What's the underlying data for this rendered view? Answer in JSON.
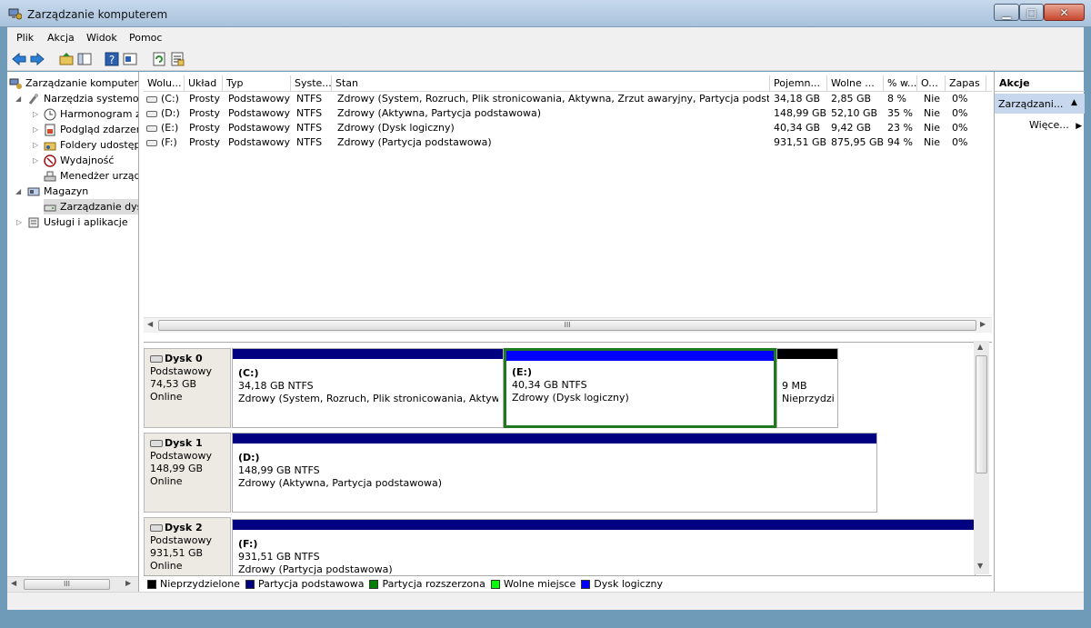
{
  "window": {
    "title": "Zarządzanie komputerem",
    "minimize": "▁",
    "maximize": "□",
    "close": "✕"
  },
  "menu": [
    "Plik",
    "Akcja",
    "Widok",
    "Pomoc"
  ],
  "toolbar": {
    "icons": [
      "back-arrow-icon",
      "forward-arrow-icon",
      "up-folder-icon",
      "show-hide-tree-icon",
      "help-icon",
      "properties-icon",
      "refresh-icon",
      "export-list-icon"
    ]
  },
  "tree": {
    "items": [
      {
        "label": "Zarządzanie komputerem (lokalne)",
        "icon": "computer-management-icon",
        "level": 0,
        "expander": "",
        "selected": false
      },
      {
        "label": "Narzędzia systemowe",
        "icon": "system-tools-icon",
        "level": 1,
        "expander": "◢",
        "selected": false
      },
      {
        "label": "Harmonogram zadań",
        "icon": "clock-icon",
        "level": 2,
        "expander": "▷",
        "selected": false
      },
      {
        "label": "Podgląd zdarzeń",
        "icon": "event-viewer-icon",
        "level": 2,
        "expander": "▷",
        "selected": false
      },
      {
        "label": "Foldery udostępnione",
        "icon": "shared-folder-icon",
        "level": 2,
        "expander": "▷",
        "selected": false
      },
      {
        "label": "Wydajność",
        "icon": "performance-icon",
        "level": 2,
        "expander": "▷",
        "selected": false
      },
      {
        "label": "Menedżer urządzeń",
        "icon": "device-manager-icon",
        "level": 2,
        "expander": "",
        "selected": false
      },
      {
        "label": "Magazyn",
        "icon": "storage-icon",
        "level": 1,
        "expander": "◢",
        "selected": false
      },
      {
        "label": "Zarządzanie dyskami",
        "icon": "disk-management-icon",
        "level": 2,
        "expander": "",
        "selected": true
      },
      {
        "label": "Usługi i aplikacje",
        "icon": "services-icon",
        "level": 1,
        "expander": "▷",
        "selected": false
      }
    ]
  },
  "volume_list": {
    "columns": [
      "Wolu...",
      "Układ",
      "Typ",
      "Syste...",
      "Stan",
      "Pojemn...",
      "Wolne ...",
      "% w...",
      "O...",
      "Zapas"
    ],
    "rows": [
      [
        "(C:)",
        "Prosty",
        "Podstawowy",
        "NTFS",
        "Zdrowy (System, Rozruch, Plik stronicowania, Aktywna, Zrzut awaryjny, Partycja podstawowa)",
        "34,18 GB",
        "2,85 GB",
        "8 %",
        "Nie",
        "0%"
      ],
      [
        "(D:)",
        "Prosty",
        "Podstawowy",
        "NTFS",
        "Zdrowy (Aktywna, Partycja podstawowa)",
        "148,99 GB",
        "52,10 GB",
        "35 %",
        "Nie",
        "0%"
      ],
      [
        "(E:)",
        "Prosty",
        "Podstawowy",
        "NTFS",
        "Zdrowy (Dysk logiczny)",
        "40,34 GB",
        "9,42 GB",
        "23 %",
        "Nie",
        "0%"
      ],
      [
        "(F:)",
        "Prosty",
        "Podstawowy",
        "NTFS",
        "Zdrowy (Partycja podstawowa)",
        "931,51 GB",
        "875,95 GB",
        "94 %",
        "Nie",
        "0%"
      ]
    ],
    "scroll_grip": "III"
  },
  "disks": [
    {
      "name": "Dysk 0",
      "type": "Podstawowy",
      "size": "74,53 GB",
      "status": "Online",
      "partitions": [
        {
          "label": "(C:)",
          "size": "34,18 GB NTFS",
          "status": "Zdrowy (System, Rozruch, Plik stronicowania, Aktywna, Zrzut awaryjny)",
          "color": "#000080",
          "selected": false
        },
        {
          "label": "(E:)",
          "size": "40,34 GB NTFS",
          "status": "Zdrowy (Dysk logiczny)",
          "color": "#0000ff",
          "selected": true
        },
        {
          "label": "",
          "size": "9 MB",
          "status": "Nieprzydzielone",
          "color": "#000000",
          "selected": false
        }
      ]
    },
    {
      "name": "Dysk 1",
      "type": "Podstawowy",
      "size": "148,99 GB",
      "status": "Online",
      "partitions": [
        {
          "label": "(D:)",
          "size": "148,99 GB NTFS",
          "status": "Zdrowy (Aktywna, Partycja podstawowa)",
          "color": "#000080",
          "selected": false
        }
      ]
    },
    {
      "name": "Dysk 2",
      "type": "Podstawowy",
      "size": "931,51 GB",
      "status": "Online",
      "partitions": [
        {
          "label": "(F:)",
          "size": "931,51 GB NTFS",
          "status": "Zdrowy (Partycja podstawowa)",
          "color": "#000080",
          "selected": false
        }
      ]
    }
  ],
  "legend": [
    {
      "label": "Nieprzydzielone",
      "color": "#000000"
    },
    {
      "label": "Partycja podstawowa",
      "color": "#000080"
    },
    {
      "label": "Partycja rozszerzona",
      "color": "#008000"
    },
    {
      "label": "Wolne miejsce",
      "color": "#00ff00"
    },
    {
      "label": "Dysk logiczny",
      "color": "#0000ff"
    }
  ],
  "actions": {
    "header": "Akcje",
    "group": "Zarządzanie dyskami",
    "group_display": "Zarządzani...",
    "collapse_arrow": "▲",
    "more": "Więcej akcji",
    "more_display": "Więce...",
    "more_arrow": "▶"
  },
  "tree_scroll_grip": "III",
  "colors": {
    "selection": "#c7d8ee",
    "selected_partition_border": "#1f7a1f"
  }
}
